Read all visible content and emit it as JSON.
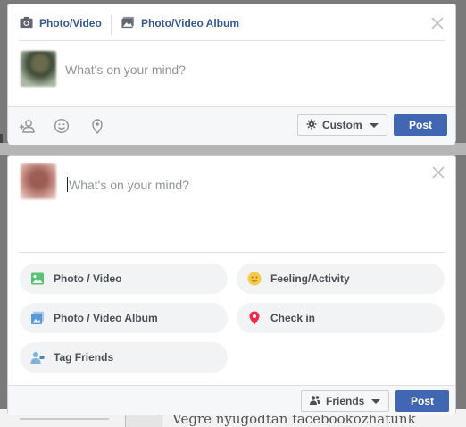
{
  "composer_top": {
    "tabs": [
      {
        "label": "Photo/Video",
        "icon": "camera-icon"
      },
      {
        "label": "Photo/Video Album",
        "icon": "photo-album-icon"
      }
    ],
    "placeholder": "What's on your mind?",
    "footer_icons": [
      "tag-people-icon",
      "feeling-smiley-icon",
      "location-pin-icon"
    ],
    "privacy_label": "Custom",
    "privacy_icon": "gear-icon",
    "post_label": "Post"
  },
  "composer_bottom": {
    "placeholder": "What's on your mind?",
    "actions": [
      {
        "label": "Photo / Video",
        "icon": "photo-icon",
        "color": "#58c472"
      },
      {
        "label": "Feeling/Activity",
        "icon": "smiley-icon",
        "color": "#f7c84a"
      },
      {
        "label": "Photo / Video Album",
        "icon": "album-icon",
        "color": "#5b9bd5"
      },
      {
        "label": "Check in",
        "icon": "map-pin-icon",
        "color": "#f02849"
      },
      {
        "label": "Tag Friends",
        "icon": "tag-friends-icon",
        "color": "#7fb1d9"
      }
    ],
    "privacy_label": "Friends",
    "privacy_icon": "friends-icon",
    "post_label": "Post"
  },
  "background": {
    "partial_text": "Végre nyugodtan facebookozhatunk"
  },
  "colors": {
    "brand_blue": "#4267b2",
    "link_blue": "#365899",
    "placeholder_grey": "#90949c"
  }
}
